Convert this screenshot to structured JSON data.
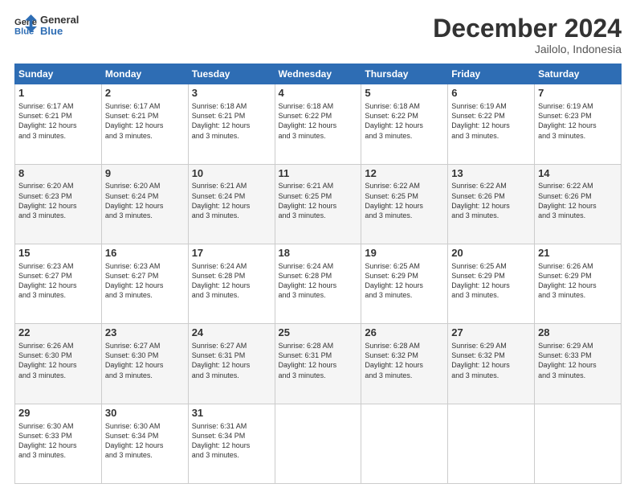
{
  "logo": {
    "line1": "General",
    "line2": "Blue"
  },
  "title": "December 2024",
  "location": "Jailolo, Indonesia",
  "days_of_week": [
    "Sunday",
    "Monday",
    "Tuesday",
    "Wednesday",
    "Thursday",
    "Friday",
    "Saturday"
  ],
  "weeks": [
    [
      {
        "day": "1",
        "sunrise": "6:17 AM",
        "sunset": "6:21 PM",
        "daylight": "12 hours and 3 minutes."
      },
      {
        "day": "2",
        "sunrise": "6:17 AM",
        "sunset": "6:21 PM",
        "daylight": "12 hours and 3 minutes."
      },
      {
        "day": "3",
        "sunrise": "6:18 AM",
        "sunset": "6:21 PM",
        "daylight": "12 hours and 3 minutes."
      },
      {
        "day": "4",
        "sunrise": "6:18 AM",
        "sunset": "6:22 PM",
        "daylight": "12 hours and 3 minutes."
      },
      {
        "day": "5",
        "sunrise": "6:18 AM",
        "sunset": "6:22 PM",
        "daylight": "12 hours and 3 minutes."
      },
      {
        "day": "6",
        "sunrise": "6:19 AM",
        "sunset": "6:22 PM",
        "daylight": "12 hours and 3 minutes."
      },
      {
        "day": "7",
        "sunrise": "6:19 AM",
        "sunset": "6:23 PM",
        "daylight": "12 hours and 3 minutes."
      }
    ],
    [
      {
        "day": "8",
        "sunrise": "6:20 AM",
        "sunset": "6:23 PM",
        "daylight": "12 hours and 3 minutes."
      },
      {
        "day": "9",
        "sunrise": "6:20 AM",
        "sunset": "6:24 PM",
        "daylight": "12 hours and 3 minutes."
      },
      {
        "day": "10",
        "sunrise": "6:21 AM",
        "sunset": "6:24 PM",
        "daylight": "12 hours and 3 minutes."
      },
      {
        "day": "11",
        "sunrise": "6:21 AM",
        "sunset": "6:25 PM",
        "daylight": "12 hours and 3 minutes."
      },
      {
        "day": "12",
        "sunrise": "6:22 AM",
        "sunset": "6:25 PM",
        "daylight": "12 hours and 3 minutes."
      },
      {
        "day": "13",
        "sunrise": "6:22 AM",
        "sunset": "6:26 PM",
        "daylight": "12 hours and 3 minutes."
      },
      {
        "day": "14",
        "sunrise": "6:22 AM",
        "sunset": "6:26 PM",
        "daylight": "12 hours and 3 minutes."
      }
    ],
    [
      {
        "day": "15",
        "sunrise": "6:23 AM",
        "sunset": "6:27 PM",
        "daylight": "12 hours and 3 minutes."
      },
      {
        "day": "16",
        "sunrise": "6:23 AM",
        "sunset": "6:27 PM",
        "daylight": "12 hours and 3 minutes."
      },
      {
        "day": "17",
        "sunrise": "6:24 AM",
        "sunset": "6:28 PM",
        "daylight": "12 hours and 3 minutes."
      },
      {
        "day": "18",
        "sunrise": "6:24 AM",
        "sunset": "6:28 PM",
        "daylight": "12 hours and 3 minutes."
      },
      {
        "day": "19",
        "sunrise": "6:25 AM",
        "sunset": "6:29 PM",
        "daylight": "12 hours and 3 minutes."
      },
      {
        "day": "20",
        "sunrise": "6:25 AM",
        "sunset": "6:29 PM",
        "daylight": "12 hours and 3 minutes."
      },
      {
        "day": "21",
        "sunrise": "6:26 AM",
        "sunset": "6:29 PM",
        "daylight": "12 hours and 3 minutes."
      }
    ],
    [
      {
        "day": "22",
        "sunrise": "6:26 AM",
        "sunset": "6:30 PM",
        "daylight": "12 hours and 3 minutes."
      },
      {
        "day": "23",
        "sunrise": "6:27 AM",
        "sunset": "6:30 PM",
        "daylight": "12 hours and 3 minutes."
      },
      {
        "day": "24",
        "sunrise": "6:27 AM",
        "sunset": "6:31 PM",
        "daylight": "12 hours and 3 minutes."
      },
      {
        "day": "25",
        "sunrise": "6:28 AM",
        "sunset": "6:31 PM",
        "daylight": "12 hours and 3 minutes."
      },
      {
        "day": "26",
        "sunrise": "6:28 AM",
        "sunset": "6:32 PM",
        "daylight": "12 hours and 3 minutes."
      },
      {
        "day": "27",
        "sunrise": "6:29 AM",
        "sunset": "6:32 PM",
        "daylight": "12 hours and 3 minutes."
      },
      {
        "day": "28",
        "sunrise": "6:29 AM",
        "sunset": "6:33 PM",
        "daylight": "12 hours and 3 minutes."
      }
    ],
    [
      {
        "day": "29",
        "sunrise": "6:30 AM",
        "sunset": "6:33 PM",
        "daylight": "12 hours and 3 minutes."
      },
      {
        "day": "30",
        "sunrise": "6:30 AM",
        "sunset": "6:34 PM",
        "daylight": "12 hours and 3 minutes."
      },
      {
        "day": "31",
        "sunrise": "6:31 AM",
        "sunset": "6:34 PM",
        "daylight": "12 hours and 3 minutes."
      },
      null,
      null,
      null,
      null
    ]
  ]
}
